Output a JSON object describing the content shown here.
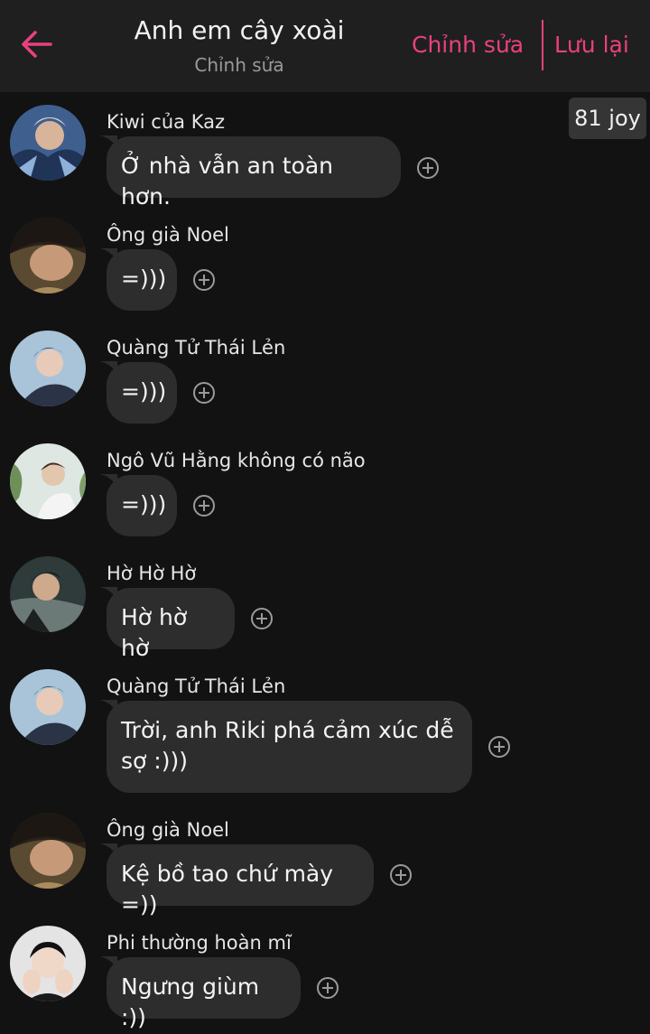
{
  "header": {
    "title": "Anh em cây xoài",
    "subtitle": "Chỉnh sửa",
    "edit_label": "Chỉnh sửa",
    "save_label": "Lưu lại",
    "accent_color": "#e8417f"
  },
  "badge": {
    "joy": "81 joy"
  },
  "messages": [
    {
      "sender": "Kiwi của Kaz",
      "text": "Ở nhà vẫn an toàn hơn."
    },
    {
      "sender": "Ông già Noel",
      "text": "=)))"
    },
    {
      "sender": "Quàng Tử Thái Lẻn",
      "text": "=)))"
    },
    {
      "sender": "Ngô Vũ Hằng không có não",
      "text": "=)))"
    },
    {
      "sender": "Hờ Hờ Hờ",
      "text": "Hờ hờ hờ"
    },
    {
      "sender": "Quàng Tử Thái Lẻn",
      "text": "Trời, anh Riki phá cảm xúc dễ sợ :)))"
    },
    {
      "sender": "Ông già Noel",
      "text": "Kệ bồ tao chứ mày =))"
    },
    {
      "sender": "Phi thường hoàn mĩ",
      "text": "Ngưng giùm :))"
    }
  ],
  "icons": {
    "back": "arrow-left-icon",
    "react": "plus-circle-icon"
  }
}
